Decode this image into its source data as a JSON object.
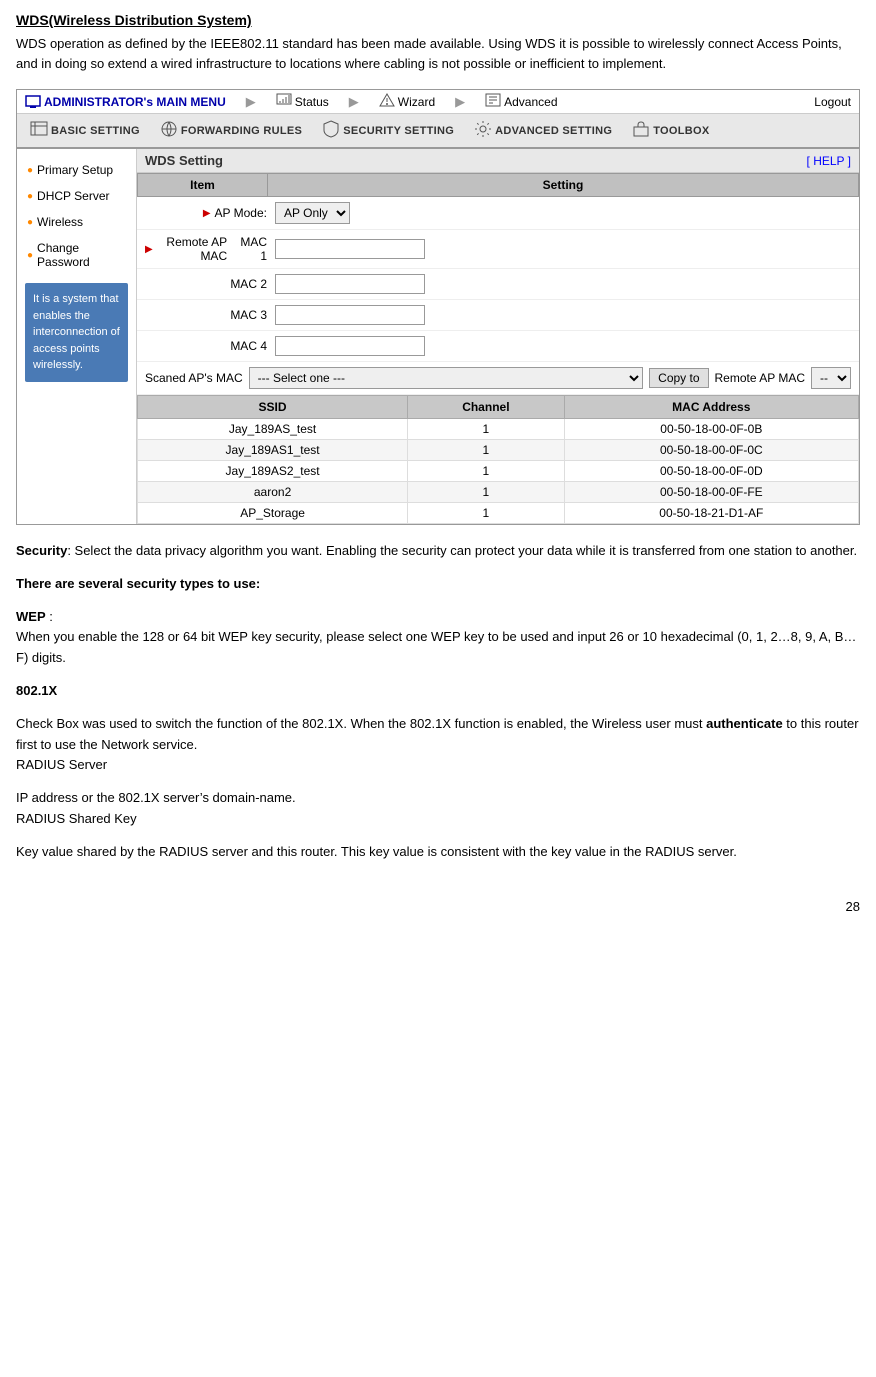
{
  "top_section": {
    "heading": "WDS(Wireless Distribution System)",
    "paragraph1": "WDS operation as defined by the IEEE802.11 standard has been made available. Using WDS it is possible to wirelessly connect Access Points, and in doing so extend a wired infrastructure to locations where cabling is not possible or inefficient to implement."
  },
  "nav": {
    "admin_label": "ADMINISTRATOR's MAIN MENU",
    "status_label": "Status",
    "wizard_label": "Wizard",
    "advanced_label": "Advanced",
    "logout_label": "Logout"
  },
  "sub_nav": {
    "items": [
      "BASIC SETTING",
      "FORWARDING RULES",
      "SECURITY SETTING",
      "ADVANCED SETTING",
      "TOOLBOX"
    ]
  },
  "sidebar": {
    "items": [
      "Primary Setup",
      "DHCP Server",
      "Wireless",
      "Change Password"
    ],
    "tip_text": "It is a system that enables the interconnection of access points wirelessly."
  },
  "panel": {
    "title": "WDS Setting",
    "help_label": "[ HELP ]"
  },
  "form": {
    "col_item": "Item",
    "col_setting": "Setting",
    "ap_mode_label": "AP Mode:",
    "ap_mode_value": "AP Only",
    "remote_ap_label": "Remote AP MAC",
    "mac1_label": "MAC 1",
    "mac2_label": "MAC 2",
    "mac3_label": "MAC 3",
    "mac4_label": "MAC 4",
    "scanned_label": "Scaned AP's MAC",
    "select_placeholder": "--- Select one ---",
    "copy_to_label": "Copy to",
    "remote_mac_label": "Remote AP MAC",
    "remote_mac_option": "--"
  },
  "ap_list": {
    "col_ssid": "SSID",
    "col_channel": "Channel",
    "col_mac": "MAC Address",
    "rows": [
      {
        "ssid": "Jay_189AS_test",
        "channel": "1",
        "mac": "00-50-18-00-0F-0B"
      },
      {
        "ssid": "Jay_189AS1_test",
        "channel": "1",
        "mac": "00-50-18-00-0F-0C"
      },
      {
        "ssid": "Jay_189AS2_test",
        "channel": "1",
        "mac": "00-50-18-00-0F-0D"
      },
      {
        "ssid": "aaron2",
        "channel": "1",
        "mac": "00-50-18-00-0F-FE"
      },
      {
        "ssid": "AP_Storage",
        "channel": "1",
        "mac": "00-50-18-21-D1-AF"
      }
    ]
  },
  "security_section": {
    "heading": "Security",
    "intro": ": Select the data privacy algorithm you want. Enabling the security can protect your data while it is transferred from one station to another.",
    "types_heading": "There are several security types to use:",
    "wep_label": "WEP",
    "wep_colon": " :",
    "wep_text": "When you enable the 128 or 64 bit WEP key security, please select one WEP key to be used and input 26 or 10 hexadecimal (0, 1, 2…8, 9, A, B…F) digits.",
    "dot1x_heading": "802.1X",
    "dot1x_text1": "Check Box was used to switch the function of the 802.1X. When the 802.1X function is enabled, the Wireless user must ",
    "dot1x_bold": "authenticate",
    "dot1x_text2": " to this router first to use the Network service.",
    "dot1x_radius": "RADIUS Server",
    "dot1x_ip_text": "IP address or the 802.1X server’s domain-name.",
    "dot1x_shared": "RADIUS Shared Key",
    "dot1x_key_text": "Key value shared by the RADIUS server and this router. This key value is consistent with the key value in the RADIUS server."
  },
  "page_number": "28"
}
